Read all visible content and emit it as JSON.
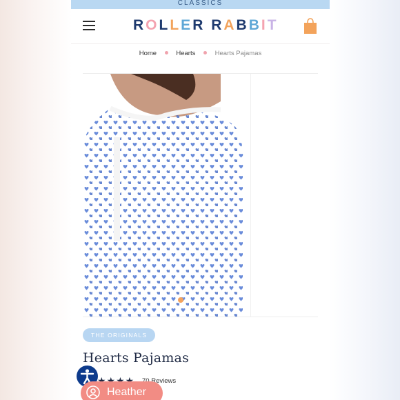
{
  "promo_banner": {
    "text": "CLASSICS"
  },
  "header": {
    "logo_letters": [
      {
        "ch": "R",
        "color": "#1e3a6e"
      },
      {
        "ch": "O",
        "color": "#f4a3b0"
      },
      {
        "ch": "L",
        "color": "#1e3a6e"
      },
      {
        "ch": "L",
        "color": "#f2a35c"
      },
      {
        "ch": "E",
        "color": "#5ea7d6"
      },
      {
        "ch": "R",
        "color": "#1e3a6e"
      },
      {
        "ch": " ",
        "color": "#ffffff"
      },
      {
        "ch": "R",
        "color": "#1e3a6e"
      },
      {
        "ch": "A",
        "color": "#f2a35c"
      },
      {
        "ch": "B",
        "color": "#1e3a6e"
      },
      {
        "ch": "B",
        "color": "#5ea7d6"
      },
      {
        "ch": "I",
        "color": "#f4a3b0"
      },
      {
        "ch": "T",
        "color": "#c9b3e6"
      }
    ],
    "menu_icon": "hamburger-menu-icon",
    "bag_icon": "shopping-bag-icon",
    "bag_color": "#f3a35b"
  },
  "breadcrumb": {
    "home": "Home",
    "category": "Hearts",
    "current": "Hearts Pajamas"
  },
  "product": {
    "badge": "THE ORIGINALS",
    "title": "Hearts Pajamas",
    "rating_stars": "★★★★",
    "reviews_text": "70 Reviews",
    "slide_dot_color": "#f4a35c",
    "heart_color": "#5a80d6",
    "accent_blue": "#b8d6f2"
  },
  "floating": {
    "accessibility_icon": "accessibility-icon",
    "user_chip_label": "Heather",
    "user_icon": "user-icon"
  }
}
